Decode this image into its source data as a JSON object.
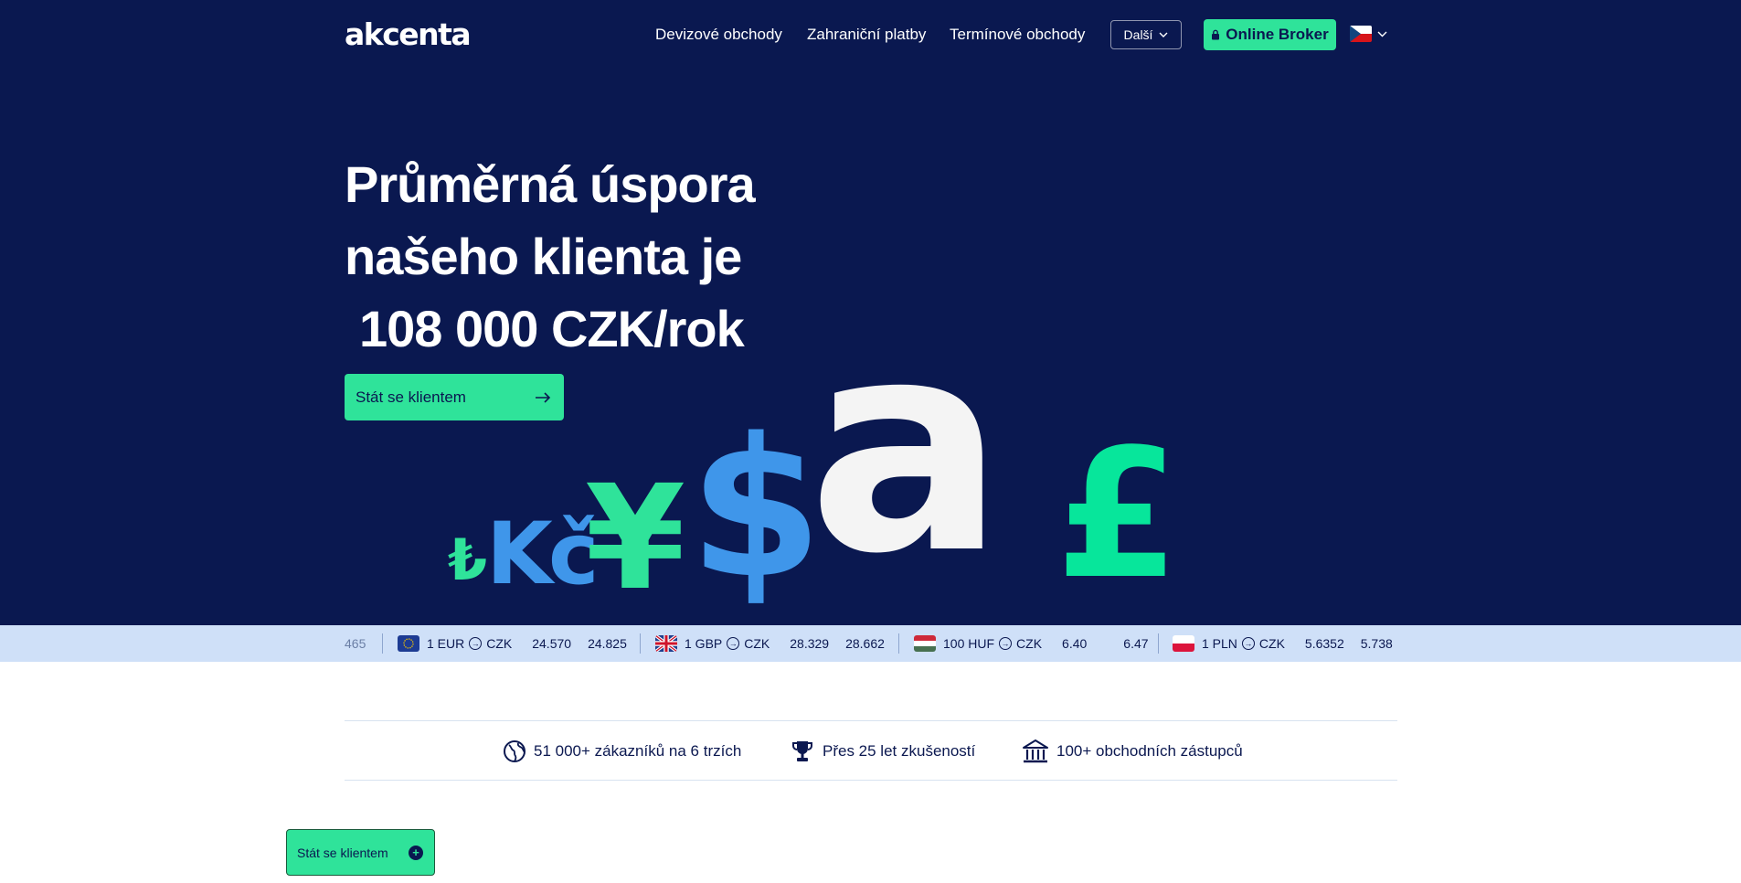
{
  "brand": {
    "logo_text": "akcenta"
  },
  "nav": {
    "links": [
      "Devizové obchody",
      "Zahraniční platby",
      "Termínové obchody"
    ],
    "more_label": "Další",
    "broker_label": "Online Broker",
    "language": "CZ"
  },
  "hero": {
    "headline_line1": "Průměrná úspora",
    "headline_line2": "našeho klienta je",
    "headline_line3": "108 000 CZK/rok",
    "cta_label": "Stát se klientem",
    "symbols": [
      "₺",
      "Kč",
      "¥",
      "$",
      "a",
      "£"
    ]
  },
  "ticker": {
    "partial_left": "465",
    "rates": [
      {
        "pair": "1 EUR",
        "quote": "CZK",
        "buy": "24.570",
        "sell": "24.825"
      },
      {
        "pair": "1 GBP",
        "quote": "CZK",
        "buy": "28.329",
        "sell": "28.662"
      },
      {
        "pair": "100 HUF",
        "quote": "CZK",
        "buy": "6.40",
        "sell": "6.47"
      },
      {
        "pair": "1 PLN",
        "quote": "CZK",
        "buy": "5.6352",
        "sell": "5.738"
      }
    ]
  },
  "stats": [
    {
      "icon": "globe-icon",
      "text": "51 000+ zákazníků na 6 trzích"
    },
    {
      "icon": "trophy-icon",
      "text": "Přes 25 let zkušeností"
    },
    {
      "icon": "bank-icon",
      "text": "100+ obchodních zástupců"
    }
  ],
  "floating_cta": {
    "label": "Stát se klientem"
  },
  "colors": {
    "navy": "#0a1850",
    "green": "#2fe39a",
    "blue": "#3f96ea",
    "ticker_bg": "#cfe0f8"
  }
}
